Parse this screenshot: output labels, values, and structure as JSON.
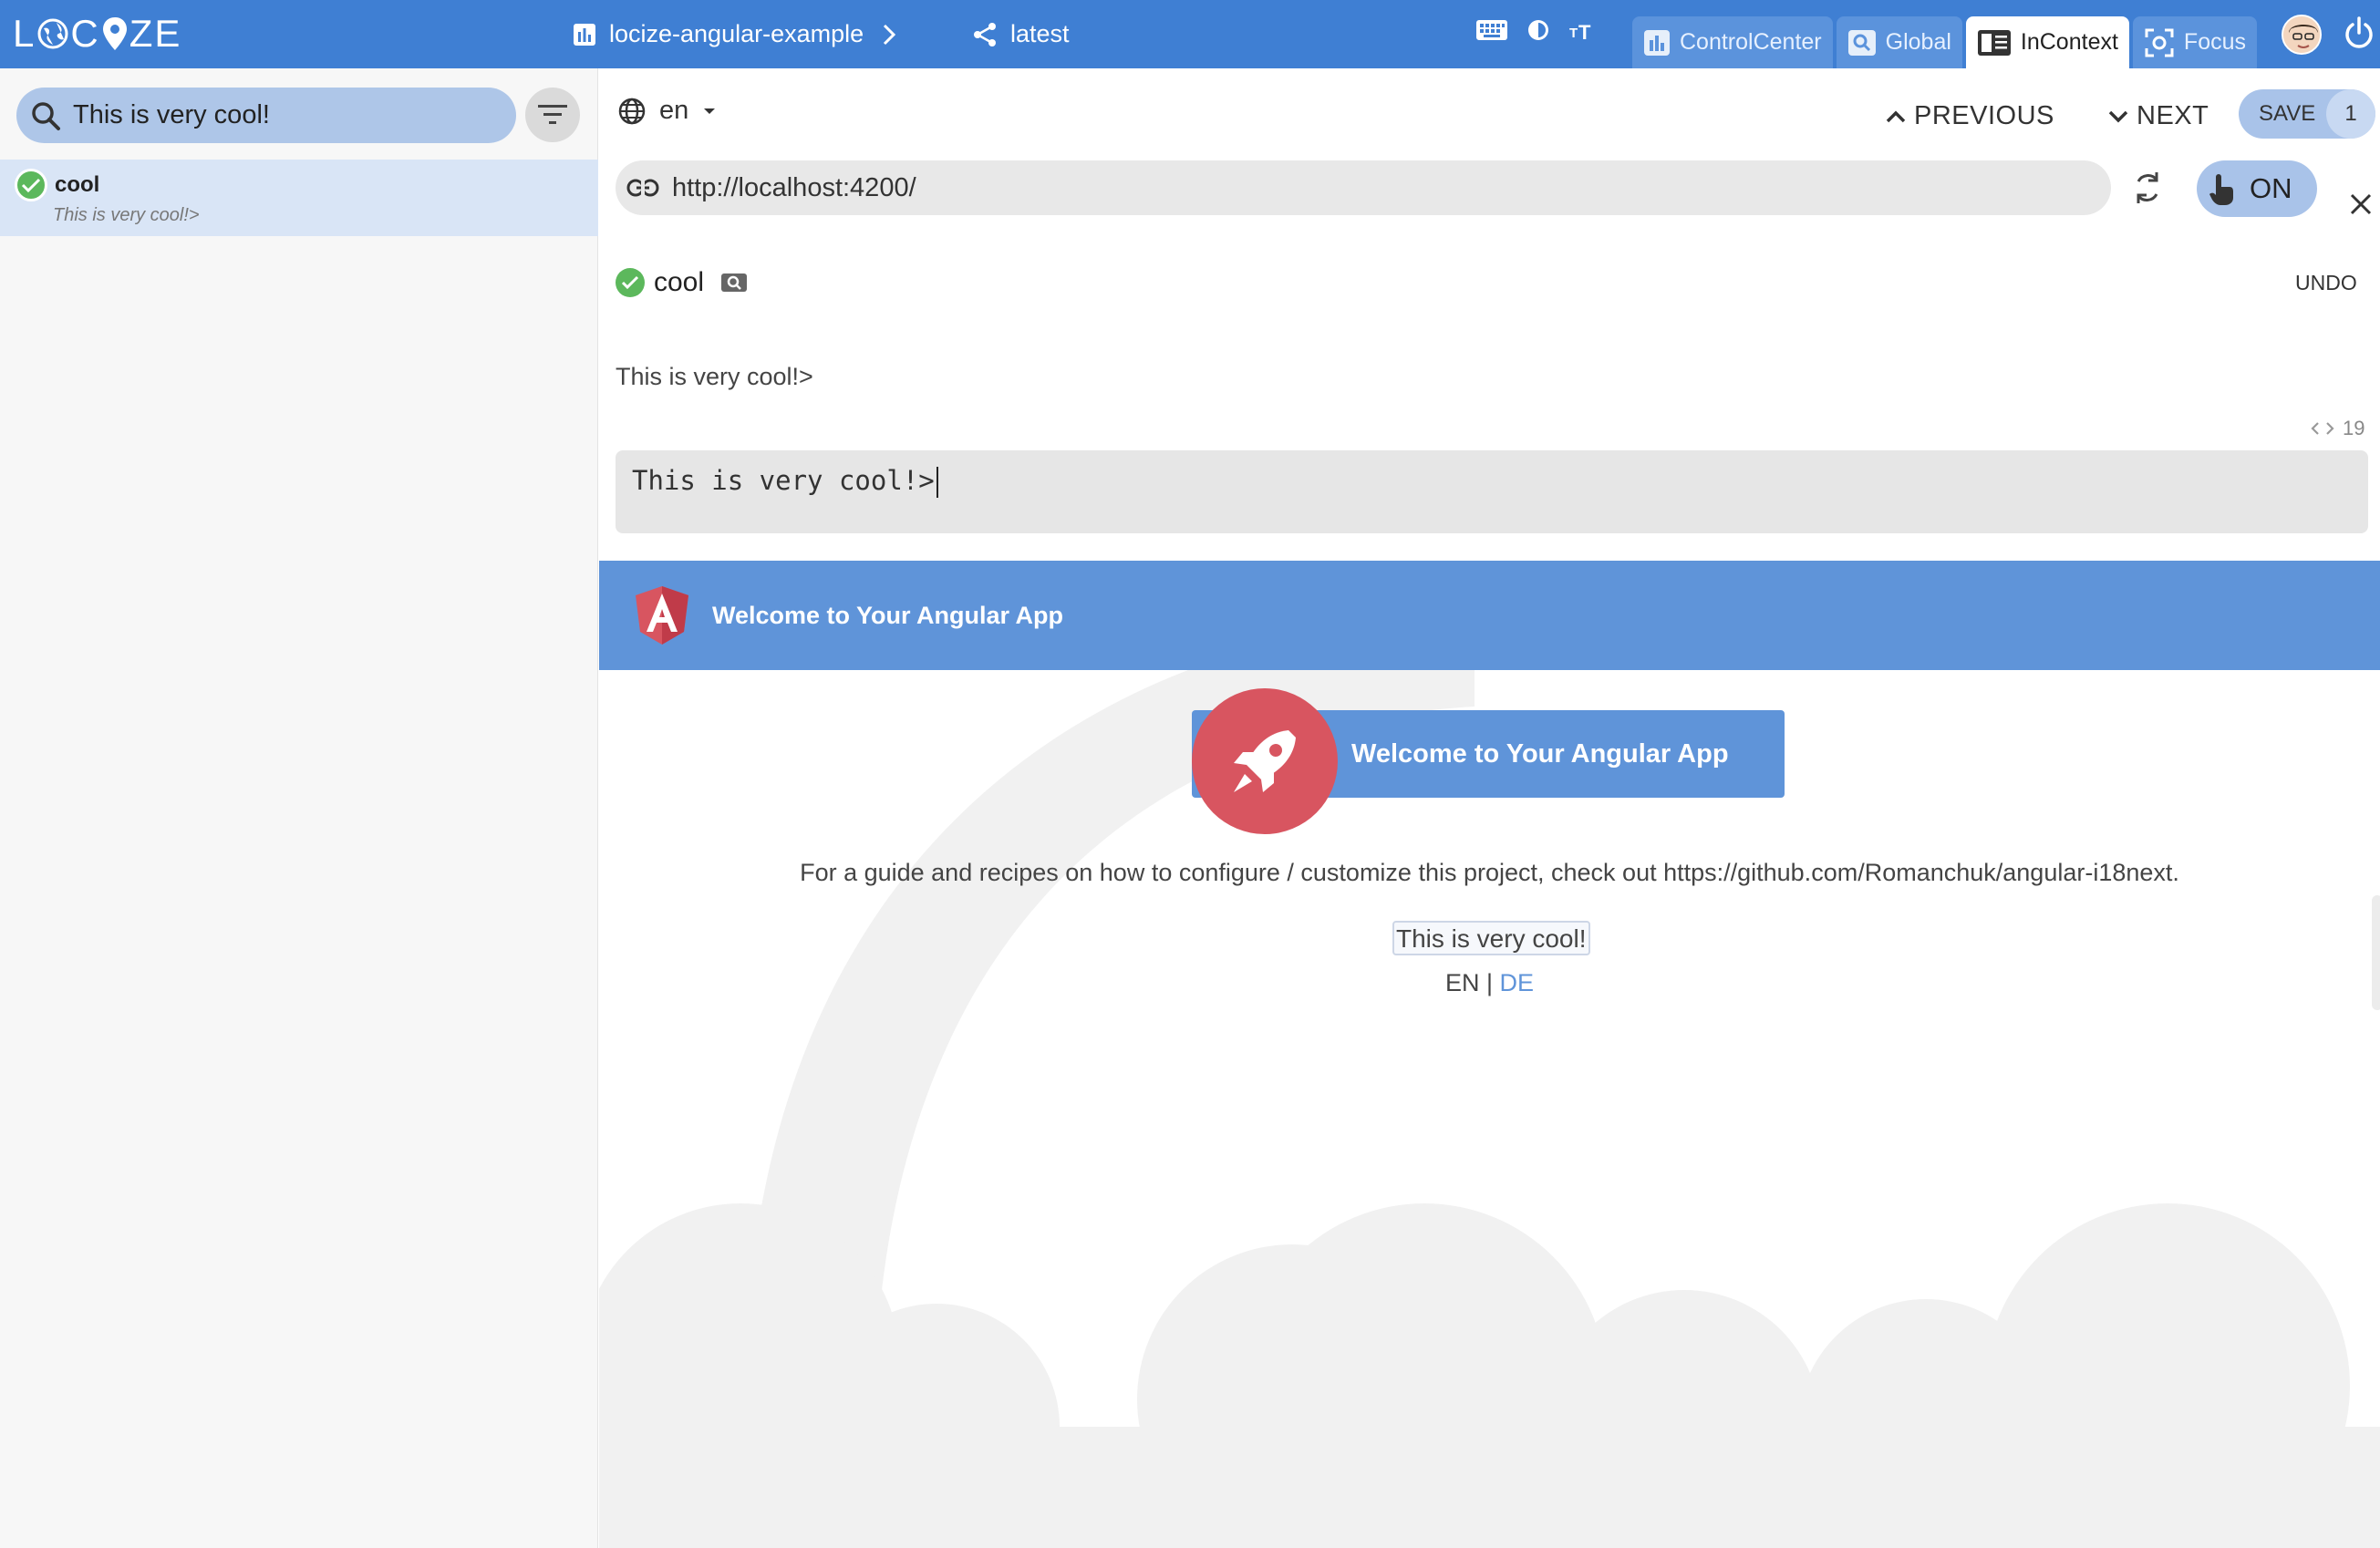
{
  "app": {
    "logo_text": "LOCIZE",
    "project_name": "locize-angular-example",
    "version_name": "latest"
  },
  "modes": [
    {
      "label": "ControlCenter",
      "icon": "bar-chart-icon"
    },
    {
      "label": "Global",
      "icon": "search-icon"
    },
    {
      "label": "InContext",
      "icon": "incontext-icon",
      "active": true
    },
    {
      "label": "Focus",
      "icon": "focus-icon"
    }
  ],
  "sidebar": {
    "search_value": "This is very cool!",
    "results": [
      {
        "key": "cool",
        "value": "This is very cool!>"
      }
    ]
  },
  "toolbar": {
    "language": "en",
    "previous_label": "PREVIOUS",
    "next_label": "NEXT",
    "save_label": "SAVE",
    "save_count": "1"
  },
  "url_bar": {
    "url": "http://localhost:4200/",
    "toggle_label": "ON"
  },
  "entry": {
    "key": "cool",
    "undo_label": "UNDO",
    "reference_text": "This is very cool!>",
    "char_count": "19",
    "editor_value": "This is very cool!>"
  },
  "preview": {
    "header_title": "Welcome to Your Angular App",
    "hero_title": "Welcome to Your Angular App",
    "guide_text": "For a guide and recipes on how to configure / customize this project, check out https://github.com/Romanchuk/angular-i18next.",
    "cool_text": "This is very cool!",
    "lang_en": "EN",
    "lang_sep": "|",
    "lang_de": "DE"
  },
  "colors": {
    "brand_blue": "#3f7fd3",
    "angular_red": "#d85560",
    "success_green": "#5cb85c"
  }
}
